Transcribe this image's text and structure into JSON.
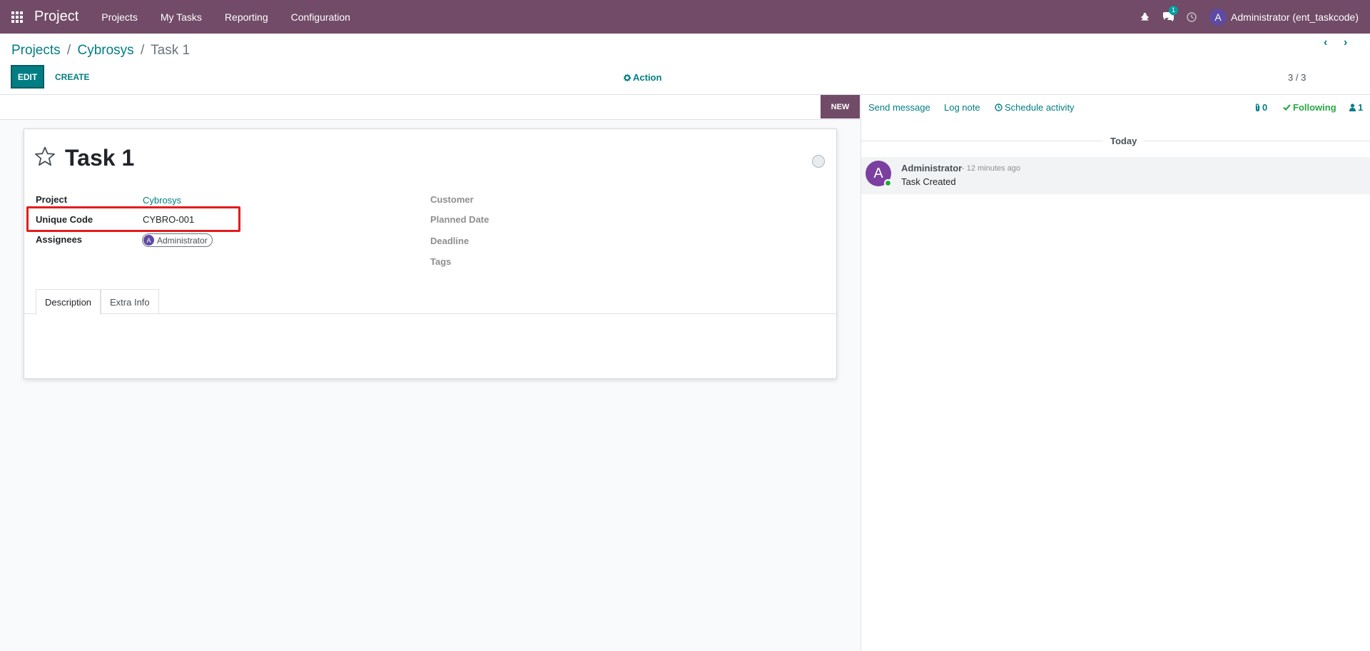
{
  "navbar": {
    "app_name": "Project",
    "menu": [
      "Projects",
      "My Tasks",
      "Reporting",
      "Configuration"
    ],
    "messages_badge": "1",
    "user_initial": "A",
    "user_name": "Administrator (ent_taskcode)"
  },
  "breadcrumb": {
    "projects": "Projects",
    "sep": "/",
    "project": "Cybrosys",
    "current": "Task 1"
  },
  "toolbar": {
    "edit": "EDIT",
    "create": "CREATE",
    "action": "Action",
    "pager": "3 / 3",
    "prev": "‹",
    "next": "›"
  },
  "stage": "NEW",
  "form": {
    "title": "Task 1",
    "fields_left": {
      "project_label": "Project",
      "project_value": "Cybrosys",
      "code_label": "Unique Code",
      "code_value": "CYBRO-001",
      "assignees_label": "Assignees",
      "assignee_initial": "A",
      "assignee_name": "Administrator"
    },
    "fields_right": {
      "customer": "Customer",
      "planned_date": "Planned Date",
      "deadline": "Deadline",
      "tags": "Tags"
    },
    "tabs": [
      "Description",
      "Extra Info"
    ]
  },
  "chatter": {
    "send_message": "Send message",
    "log_note": "Log note",
    "schedule_activity": "Schedule activity",
    "attachments": "0",
    "following": "Following",
    "followers": "1",
    "today": "Today",
    "message": {
      "avatar": "A",
      "author": "Administrator",
      "time": "- 12 minutes ago",
      "body": "Task Created"
    }
  },
  "colors": {
    "brand": "#714b67",
    "accent": "#017e84",
    "highlight": "#e31d1d",
    "following": "#28a745"
  }
}
